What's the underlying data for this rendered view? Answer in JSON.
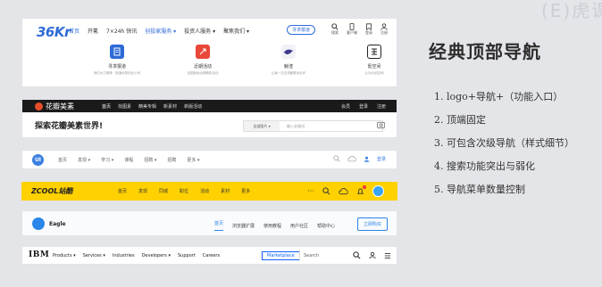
{
  "colors": {
    "background": "#e4e5e9",
    "kr_blue": "#2e6bd6",
    "zcool_yellow": "#ffd100",
    "eagle_blue": "#2a86e8",
    "ibm_blue": "#0f62fe"
  },
  "watermark": "(E)虎课",
  "slide": {
    "title": "经典顶部导航",
    "points": [
      "1. logo+导航+（功能入口）",
      "2. 顶端固定",
      "3. 可包含次级导航（样式细节）",
      "4. 搜索功能突出与弱化",
      "5. 导航菜单数量控制"
    ]
  },
  "kr": {
    "logo_a": "36",
    "logo_b": "Kr",
    "nav": [
      "首页",
      "开氪",
      "7×24h 快讯",
      "创投家服务 ▾",
      "投资人服务 ▾",
      "聚焦我们 ▾"
    ],
    "action": "寻求报道",
    "icons": [
      {
        "icon": "search-icon",
        "label": "搜索"
      },
      {
        "icon": "phone-icon",
        "label": "客户端"
      },
      {
        "icon": "bookmark-icon",
        "label": "登录"
      },
      {
        "icon": "user-icon",
        "label": "注册"
      }
    ],
    "cards": [
      {
        "title": "寻求报道",
        "sub": "我们大力推荐 · 报道优秀创业公司"
      },
      {
        "title": "近期活动",
        "sub": "全国各地近期精彩活动"
      },
      {
        "title": "鲸渲",
        "sub": "让每一次交流都推动合作"
      },
      {
        "title": "氪空间",
        "sub": "让为众创空间"
      }
    ]
  },
  "huaban": {
    "logo": "花瓣美素",
    "nav": [
      "首页",
      "找图素",
      "精美专辑",
      "新素材",
      "新版活动"
    ],
    "right": [
      "会员",
      "登录",
      "注册"
    ],
    "slogan": "探索花瓣美素世界!",
    "search_category": "全部图片 ▾",
    "search_placeholder": "输入关键词"
  },
  "uichina": {
    "logo": "UI",
    "nav": [
      "首页",
      "发现 ▾",
      "学习 ▾",
      "课程",
      "招聘 ▾",
      "招聘",
      "更多 ▾"
    ],
    "login": "登录"
  },
  "zcool": {
    "logo": "ZCOOL站酷",
    "nav": [
      "首页",
      "发现",
      "同城",
      "职位",
      "活动",
      "素材",
      "更多"
    ],
    "more": "···"
  },
  "eagle": {
    "logo": "Eagle",
    "nav": [
      "首页",
      "浏览器扩展",
      "使用教程",
      "用户社区",
      "帮助中心"
    ],
    "button": "立即购买"
  },
  "ibm": {
    "logo": "IBM",
    "nav": [
      "Products ▾",
      "Services ▾",
      "Industries",
      "Developers ▾",
      "Support",
      "Careers"
    ],
    "marketplace": "Marketplace",
    "search_placeholder": "Search"
  }
}
